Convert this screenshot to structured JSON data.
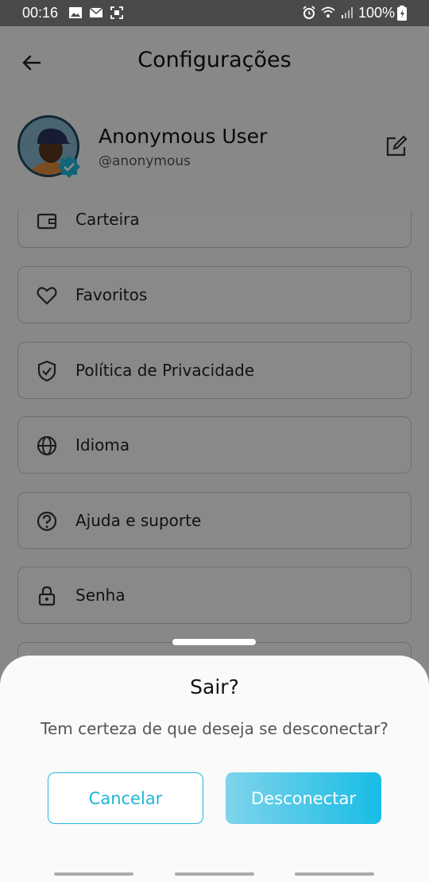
{
  "status_bar": {
    "time": "00:16",
    "battery": "100%",
    "icons_left": [
      "image-icon",
      "mail-icon",
      "screenshot-icon"
    ],
    "icons_right": [
      "alarm-icon",
      "wifi-icon",
      "signal-icon",
      "battery-icon"
    ]
  },
  "header": {
    "title": "Configurações"
  },
  "profile": {
    "name": "Anonymous User",
    "handle": "@anonymous"
  },
  "menu": {
    "items": [
      {
        "label": "Carteira",
        "icon": "wallet-icon"
      },
      {
        "label": "Favoritos",
        "icon": "heart-icon"
      },
      {
        "label": "Política de Privacidade",
        "icon": "shield-icon"
      },
      {
        "label": "Idioma",
        "icon": "globe-icon"
      },
      {
        "label": "Ajuda e suporte",
        "icon": "help-icon"
      },
      {
        "label": "Senha",
        "icon": "lock-icon"
      }
    ]
  },
  "dialog": {
    "title": "Sair?",
    "message": "Tem certeza de que deseja se desconectar?",
    "cancel_label": "Cancelar",
    "confirm_label": "Desconectar"
  },
  "colors": {
    "accent": "#1fb8d8",
    "accent_light": "#7fd4ea"
  }
}
